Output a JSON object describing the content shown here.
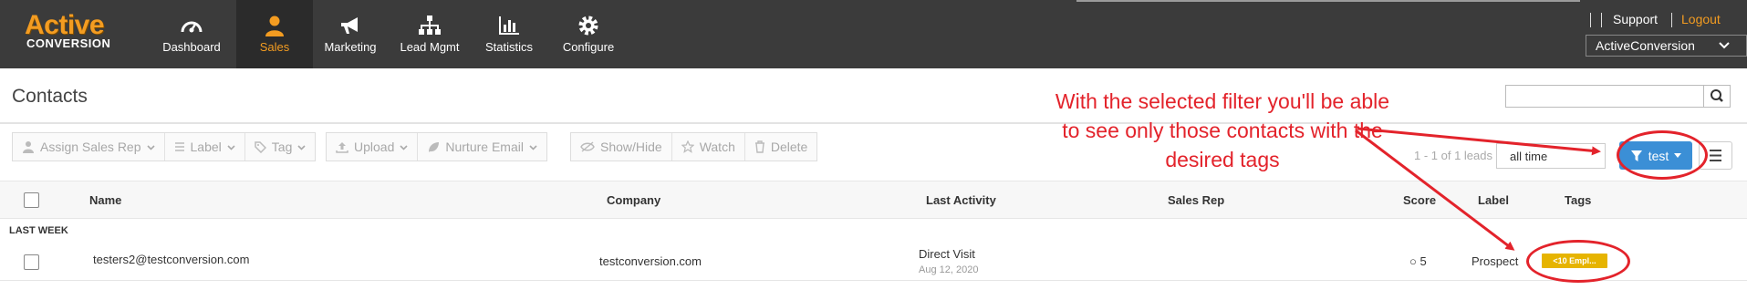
{
  "brand": {
    "line1": "Active",
    "line2": "CONVERSION"
  },
  "nav": [
    {
      "label": "Dashboard",
      "icon": "dashboard-gauge-icon"
    },
    {
      "label": "Sales",
      "icon": "person-icon",
      "active": true
    },
    {
      "label": "Marketing",
      "icon": "megaphone-icon"
    },
    {
      "label": "Lead Mgmt",
      "icon": "org-chart-icon"
    },
    {
      "label": "Statistics",
      "icon": "bar-chart-icon"
    },
    {
      "label": "Configure",
      "icon": "gear-icon"
    }
  ],
  "header": {
    "support": "Support",
    "logout": "Logout",
    "account": "ActiveConversion"
  },
  "page": {
    "title": "Contacts"
  },
  "toolbar": {
    "assign_sales_rep": "Assign Sales Rep",
    "label": "Label",
    "tag": "Tag",
    "upload": "Upload",
    "nurture_email": "Nurture Email",
    "show_hide": "Show/Hide",
    "watch": "Watch",
    "delete": "Delete"
  },
  "pager": {
    "text": "1 - 1 of 1 leads"
  },
  "range": {
    "value": "all time"
  },
  "filter": {
    "label": "test"
  },
  "table": {
    "columns": {
      "name": "Name",
      "company": "Company",
      "last_activity": "Last Activity",
      "sales_rep": "Sales Rep",
      "score": "Score",
      "label": "Label",
      "tags": "Tags"
    },
    "group": "LAST WEEK",
    "rows": [
      {
        "name": "testers2@testconversion.com",
        "company": "testconversion.com",
        "last_activity": "Direct Visit",
        "last_activity_date": "Aug 12, 2020",
        "sales_rep": "",
        "score": "○ 5",
        "label": "Prospect",
        "tag": "<10 Empl..."
      }
    ]
  },
  "annotation": {
    "text": "With the selected filter you'll be able to see only those contacts with the desired tags",
    "color": "#e3232b"
  },
  "colors": {
    "topbar": "#3b3b3b",
    "accent": "#f39c21",
    "filter_button": "#3b8fd6",
    "tag": "#e6b400"
  }
}
